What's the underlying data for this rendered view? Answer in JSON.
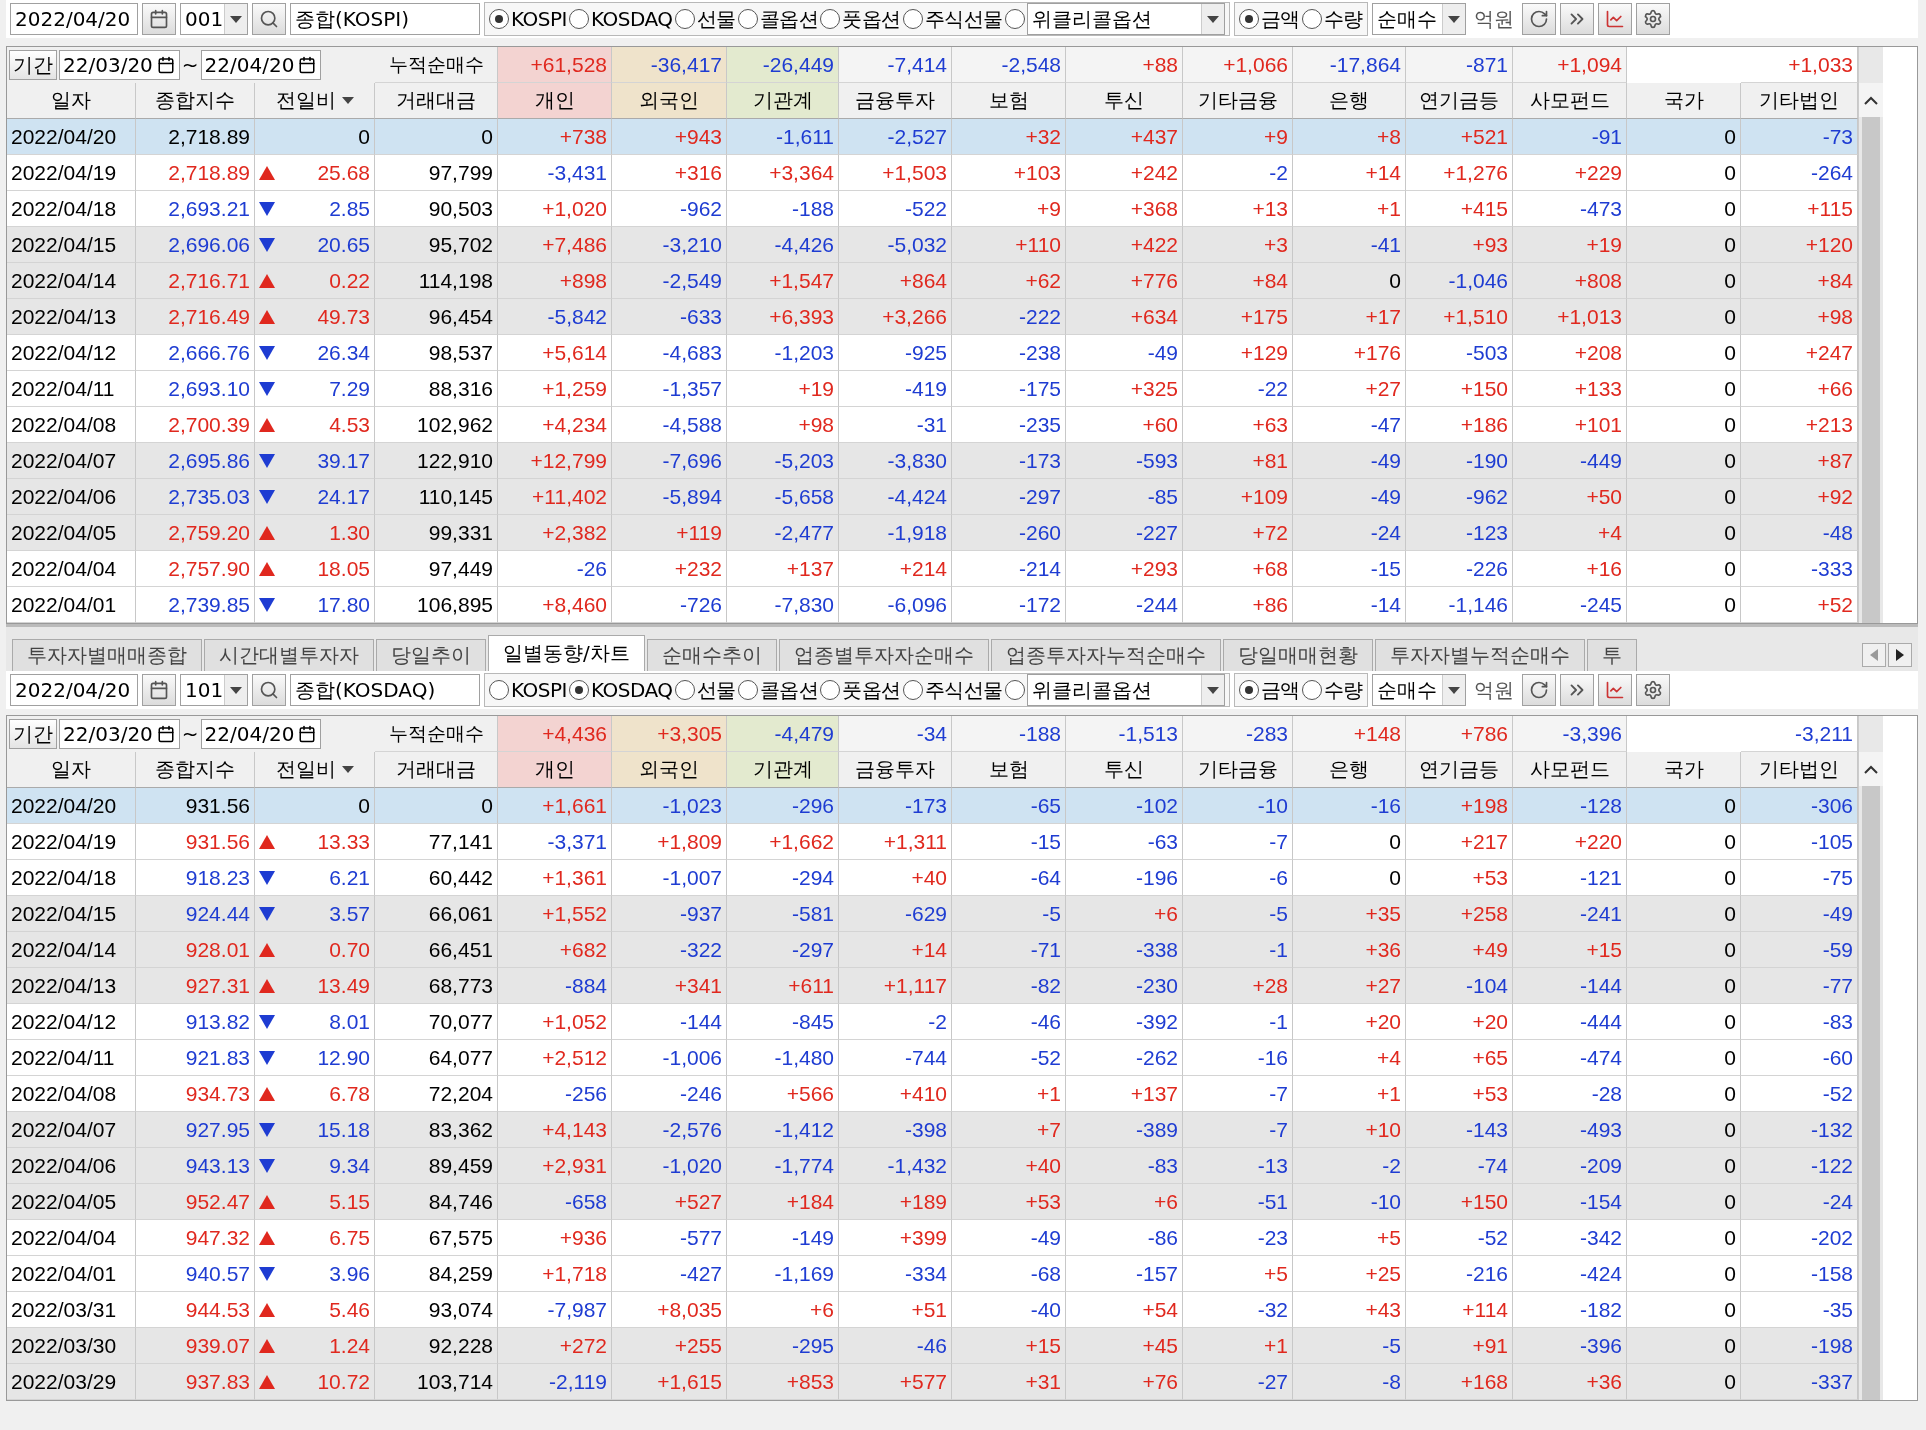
{
  "top_panel": {
    "toolbar": {
      "date": "2022/04/20",
      "code": "001",
      "name": "종합(KOSPI)",
      "markets": [
        {
          "label": "KOSPI",
          "selected": true
        },
        {
          "label": "KOSDAQ",
          "selected": false
        },
        {
          "label": "선물",
          "selected": false
        },
        {
          "label": "콜옵션",
          "selected": false
        },
        {
          "label": "풋옵션",
          "selected": false
        },
        {
          "label": "주식선물",
          "selected": false
        }
      ],
      "weekly": {
        "selected": false,
        "value": "위클리콜옵션"
      },
      "units": [
        {
          "label": "금액",
          "selected": true
        },
        {
          "label": "수량",
          "selected": false
        }
      ],
      "mode": "순매수",
      "unit_label": "억원"
    },
    "summary": {
      "button": "기간",
      "from": "22/03/20",
      "separator": "~",
      "to": "22/04/20",
      "label": "누적순매수",
      "values": [
        "+61,528",
        "-36,417",
        "-26,449",
        "-7,414",
        "-2,548",
        "+88",
        "+1,066",
        "-17,864",
        "-871",
        "+1,094"
      ],
      "other_corporations": "+1,033"
    },
    "columns": [
      "일자",
      "종합지수",
      "전일비",
      "거래대금",
      "개인",
      "외국인",
      "기관계",
      "금융투자",
      "보험",
      "투신",
      "기타금융",
      "은행",
      "연기금등",
      "사모펀드",
      "국가",
      "기타법인"
    ],
    "rows": [
      {
        "selected": true,
        "date": "2022/04/20",
        "index": "2,718.89",
        "kind": "flat",
        "change": "0",
        "volume": "0",
        "values": [
          "+738",
          "+943",
          "-1,611",
          "-2,527",
          "+32",
          "+437",
          "+9",
          "+8",
          "+521",
          "-91",
          "0",
          "-73"
        ]
      },
      {
        "selected": false,
        "date": "2022/04/19",
        "index": "2,718.89",
        "kind": "up",
        "change": "25.68",
        "volume": "97,799",
        "values": [
          "-3,431",
          "+316",
          "+3,364",
          "+1,503",
          "+103",
          "+242",
          "-2",
          "+14",
          "+1,276",
          "+229",
          "0",
          "-264"
        ]
      },
      {
        "selected": false,
        "date": "2022/04/18",
        "index": "2,693.21",
        "kind": "down",
        "change": "2.85",
        "volume": "90,503",
        "values": [
          "+1,020",
          "-962",
          "-188",
          "-522",
          "+9",
          "+368",
          "+13",
          "+1",
          "+415",
          "-473",
          "0",
          "+115"
        ]
      },
      {
        "selected": false,
        "date": "2022/04/15",
        "index": "2,696.06",
        "kind": "down",
        "change": "20.65",
        "volume": "95,702",
        "values": [
          "+7,486",
          "-3,210",
          "-4,426",
          "-5,032",
          "+110",
          "+422",
          "+3",
          "-41",
          "+93",
          "+19",
          "0",
          "+120"
        ]
      },
      {
        "selected": false,
        "date": "2022/04/14",
        "index": "2,716.71",
        "kind": "up",
        "change": "0.22",
        "volume": "114,198",
        "values": [
          "+898",
          "-2,549",
          "+1,547",
          "+864",
          "+62",
          "+776",
          "+84",
          "0",
          "-1,046",
          "+808",
          "0",
          "+84"
        ]
      },
      {
        "selected": false,
        "date": "2022/04/13",
        "index": "2,716.49",
        "kind": "up",
        "change": "49.73",
        "volume": "96,454",
        "values": [
          "-5,842",
          "-633",
          "+6,393",
          "+3,266",
          "-222",
          "+634",
          "+175",
          "+17",
          "+1,510",
          "+1,013",
          "0",
          "+98"
        ]
      },
      {
        "selected": false,
        "date": "2022/04/12",
        "index": "2,666.76",
        "kind": "down",
        "change": "26.34",
        "volume": "98,537",
        "values": [
          "+5,614",
          "-4,683",
          "-1,203",
          "-925",
          "-238",
          "-49",
          "+129",
          "+176",
          "-503",
          "+208",
          "0",
          "+247"
        ]
      },
      {
        "selected": false,
        "date": "2022/04/11",
        "index": "2,693.10",
        "kind": "down",
        "change": "7.29",
        "volume": "88,316",
        "values": [
          "+1,259",
          "-1,357",
          "+19",
          "-419",
          "-175",
          "+325",
          "-22",
          "+27",
          "+150",
          "+133",
          "0",
          "+66"
        ]
      },
      {
        "selected": false,
        "date": "2022/04/08",
        "index": "2,700.39",
        "kind": "up",
        "change": "4.53",
        "volume": "102,962",
        "values": [
          "+4,234",
          "-4,588",
          "+98",
          "-31",
          "-235",
          "+60",
          "+63",
          "-47",
          "+186",
          "+101",
          "0",
          "+213"
        ]
      },
      {
        "selected": false,
        "date": "2022/04/07",
        "index": "2,695.86",
        "kind": "down",
        "change": "39.17",
        "volume": "122,910",
        "values": [
          "+12,799",
          "-7,696",
          "-5,203",
          "-3,830",
          "-173",
          "-593",
          "+81",
          "-49",
          "-190",
          "-449",
          "0",
          "+87"
        ]
      },
      {
        "selected": false,
        "date": "2022/04/06",
        "index": "2,735.03",
        "kind": "down",
        "change": "24.17",
        "volume": "110,145",
        "values": [
          "+11,402",
          "-5,894",
          "-5,658",
          "-4,424",
          "-297",
          "-85",
          "+109",
          "-49",
          "-962",
          "+50",
          "0",
          "+92"
        ]
      },
      {
        "selected": false,
        "date": "2022/04/05",
        "index": "2,759.20",
        "kind": "up",
        "change": "1.30",
        "volume": "99,331",
        "values": [
          "+2,382",
          "+119",
          "-2,477",
          "-1,918",
          "-260",
          "-227",
          "+72",
          "-24",
          "-123",
          "+4",
          "0",
          "-48"
        ]
      },
      {
        "selected": false,
        "date": "2022/04/04",
        "index": "2,757.90",
        "kind": "up",
        "change": "18.05",
        "volume": "97,449",
        "values": [
          "-26",
          "+232",
          "+137",
          "+214",
          "-214",
          "+293",
          "+68",
          "-15",
          "-226",
          "+16",
          "0",
          "-333"
        ]
      },
      {
        "selected": false,
        "date": "2022/04/01",
        "index": "2,739.85",
        "kind": "down",
        "change": "17.80",
        "volume": "106,895",
        "values": [
          "+8,460",
          "-726",
          "-7,830",
          "-6,096",
          "-172",
          "-244",
          "+86",
          "-14",
          "-1,146",
          "-245",
          "0",
          "+52"
        ]
      }
    ]
  },
  "tabs": [
    {
      "label": "투자자별매매종합",
      "selected": false
    },
    {
      "label": "시간대별투자자",
      "selected": false
    },
    {
      "label": "당일추이",
      "selected": false
    },
    {
      "label": "일별동향/차트",
      "selected": true
    },
    {
      "label": "순매수추이",
      "selected": false
    },
    {
      "label": "업종별투자자순매수",
      "selected": false
    },
    {
      "label": "업종투자자누적순매수",
      "selected": false
    },
    {
      "label": "당일매매현황",
      "selected": false
    },
    {
      "label": "투자자별누적순매수",
      "selected": false
    },
    {
      "label": "투",
      "selected": false
    }
  ],
  "bottom_panel": {
    "toolbar": {
      "date": "2022/04/20",
      "code": "101",
      "name": "종합(KOSDAQ)",
      "markets": [
        {
          "label": "KOSPI",
          "selected": false
        },
        {
          "label": "KOSDAQ",
          "selected": true
        },
        {
          "label": "선물",
          "selected": false
        },
        {
          "label": "콜옵션",
          "selected": false
        },
        {
          "label": "풋옵션",
          "selected": false
        },
        {
          "label": "주식선물",
          "selected": false
        }
      ],
      "weekly": {
        "selected": false,
        "value": "위클리콜옵션"
      },
      "units": [
        {
          "label": "금액",
          "selected": true
        },
        {
          "label": "수량",
          "selected": false
        }
      ],
      "mode": "순매수",
      "unit_label": "억원"
    },
    "summary": {
      "button": "기간",
      "from": "22/03/20",
      "separator": "~",
      "to": "22/04/20",
      "label": "누적순매수",
      "values": [
        "+4,436",
        "+3,305",
        "-4,479",
        "-34",
        "-188",
        "-1,513",
        "-283",
        "+148",
        "+786",
        "-3,396"
      ],
      "other_corporations": "-3,211"
    },
    "columns": [
      "일자",
      "종합지수",
      "전일비",
      "거래대금",
      "개인",
      "외국인",
      "기관계",
      "금융투자",
      "보험",
      "투신",
      "기타금융",
      "은행",
      "연기금등",
      "사모펀드",
      "국가",
      "기타법인"
    ],
    "rows": [
      {
        "selected": true,
        "date": "2022/04/20",
        "index": "931.56",
        "kind": "flat",
        "change": "0",
        "volume": "0",
        "values": [
          "+1,661",
          "-1,023",
          "-296",
          "-173",
          "-65",
          "-102",
          "-10",
          "-16",
          "+198",
          "-128",
          "0",
          "-306"
        ]
      },
      {
        "selected": false,
        "date": "2022/04/19",
        "index": "931.56",
        "kind": "up",
        "change": "13.33",
        "volume": "77,141",
        "values": [
          "-3,371",
          "+1,809",
          "+1,662",
          "+1,311",
          "-15",
          "-63",
          "-7",
          "0",
          "+217",
          "+220",
          "0",
          "-105"
        ]
      },
      {
        "selected": false,
        "date": "2022/04/18",
        "index": "918.23",
        "kind": "down",
        "change": "6.21",
        "volume": "60,442",
        "values": [
          "+1,361",
          "-1,007",
          "-294",
          "+40",
          "-64",
          "-196",
          "-6",
          "0",
          "+53",
          "-121",
          "0",
          "-75"
        ]
      },
      {
        "selected": false,
        "date": "2022/04/15",
        "index": "924.44",
        "kind": "down",
        "change": "3.57",
        "volume": "66,061",
        "values": [
          "+1,552",
          "-937",
          "-581",
          "-629",
          "-5",
          "+6",
          "-5",
          "+35",
          "+258",
          "-241",
          "0",
          "-49"
        ]
      },
      {
        "selected": false,
        "date": "2022/04/14",
        "index": "928.01",
        "kind": "up",
        "change": "0.70",
        "volume": "66,451",
        "values": [
          "+682",
          "-322",
          "-297",
          "+14",
          "-71",
          "-338",
          "-1",
          "+36",
          "+49",
          "+15",
          "0",
          "-59"
        ]
      },
      {
        "selected": false,
        "date": "2022/04/13",
        "index": "927.31",
        "kind": "up",
        "change": "13.49",
        "volume": "68,773",
        "values": [
          "-884",
          "+341",
          "+611",
          "+1,117",
          "-82",
          "-230",
          "+28",
          "+27",
          "-104",
          "-144",
          "0",
          "-77"
        ]
      },
      {
        "selected": false,
        "date": "2022/04/12",
        "index": "913.82",
        "kind": "down",
        "change": "8.01",
        "volume": "70,077",
        "values": [
          "+1,052",
          "-144",
          "-845",
          "-2",
          "-46",
          "-392",
          "-1",
          "+20",
          "+20",
          "-444",
          "0",
          "-83"
        ]
      },
      {
        "selected": false,
        "date": "2022/04/11",
        "index": "921.83",
        "kind": "down",
        "change": "12.90",
        "volume": "64,077",
        "values": [
          "+2,512",
          "-1,006",
          "-1,480",
          "-744",
          "-52",
          "-262",
          "-16",
          "+4",
          "+65",
          "-474",
          "0",
          "-60"
        ]
      },
      {
        "selected": false,
        "date": "2022/04/08",
        "index": "934.73",
        "kind": "up",
        "change": "6.78",
        "volume": "72,204",
        "values": [
          "-256",
          "-246",
          "+566",
          "+410",
          "+1",
          "+137",
          "-7",
          "+1",
          "+53",
          "-28",
          "0",
          "-52"
        ]
      },
      {
        "selected": false,
        "date": "2022/04/07",
        "index": "927.95",
        "kind": "down",
        "change": "15.18",
        "volume": "83,362",
        "values": [
          "+4,143",
          "-2,576",
          "-1,412",
          "-398",
          "+7",
          "-389",
          "-7",
          "+10",
          "-143",
          "-493",
          "0",
          "-132"
        ]
      },
      {
        "selected": false,
        "date": "2022/04/06",
        "index": "943.13",
        "kind": "down",
        "change": "9.34",
        "volume": "89,459",
        "values": [
          "+2,931",
          "-1,020",
          "-1,774",
          "-1,432",
          "+40",
          "-83",
          "-13",
          "-2",
          "-74",
          "-209",
          "0",
          "-122"
        ]
      },
      {
        "selected": false,
        "date": "2022/04/05",
        "index": "952.47",
        "kind": "up",
        "change": "5.15",
        "volume": "84,746",
        "values": [
          "-658",
          "+527",
          "+184",
          "+189",
          "+53",
          "+6",
          "-51",
          "-10",
          "+150",
          "-154",
          "0",
          "-24"
        ]
      },
      {
        "selected": false,
        "date": "2022/04/04",
        "index": "947.32",
        "kind": "up",
        "change": "6.75",
        "volume": "67,575",
        "values": [
          "+936",
          "-577",
          "-149",
          "+399",
          "-49",
          "-86",
          "-23",
          "+5",
          "-52",
          "-342",
          "0",
          "-202"
        ]
      },
      {
        "selected": false,
        "date": "2022/04/01",
        "index": "940.57",
        "kind": "down",
        "change": "3.96",
        "volume": "84,259",
        "values": [
          "+1,718",
          "-427",
          "-1,169",
          "-334",
          "-68",
          "-157",
          "+5",
          "+25",
          "-216",
          "-424",
          "0",
          "-158"
        ]
      },
      {
        "selected": false,
        "date": "2022/03/31",
        "index": "944.53",
        "kind": "up",
        "change": "5.46",
        "volume": "93,074",
        "values": [
          "-7,987",
          "+8,035",
          "+6",
          "+51",
          "-40",
          "+54",
          "-32",
          "+43",
          "+114",
          "-182",
          "0",
          "-35"
        ]
      },
      {
        "selected": false,
        "date": "2022/03/30",
        "index": "939.07",
        "kind": "up",
        "change": "1.24",
        "volume": "92,228",
        "values": [
          "+272",
          "+255",
          "-295",
          "-46",
          "+15",
          "+45",
          "+1",
          "-5",
          "+91",
          "-396",
          "0",
          "-198"
        ]
      },
      {
        "selected": false,
        "date": "2022/03/29",
        "index": "937.83",
        "kind": "up",
        "change": "10.72",
        "volume": "103,714",
        "values": [
          "-2,119",
          "+1,615",
          "+853",
          "+577",
          "+31",
          "+76",
          "-27",
          "-8",
          "+168",
          "+36",
          "0",
          "-337"
        ]
      }
    ]
  }
}
